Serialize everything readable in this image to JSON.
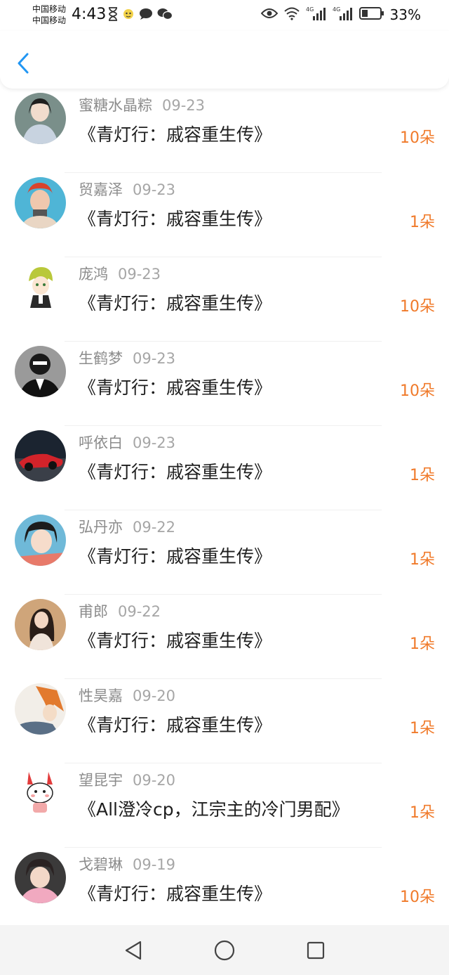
{
  "status_bar": {
    "carrier_1": "中国移动",
    "carrier_2": "中国移动",
    "time": "4:43",
    "signal_1_label": "4G",
    "signal_2_label": "4G",
    "battery": "33%",
    "battery_level": 0.33
  },
  "header": {
    "back_icon": "chevron-left-icon",
    "accent": "#2196f3"
  },
  "amount_color": "#f07a2a",
  "rows": [
    {
      "name": "蜜糖水晶粽",
      "date": "09-23",
      "book": "《青灯行：戚容重生传》",
      "amount": "10朵"
    },
    {
      "name": "贸嘉泽",
      "date": "09-23",
      "book": "《青灯行：戚容重生传》",
      "amount": "1朵"
    },
    {
      "name": "庞鸿",
      "date": "09-23",
      "book": "《青灯行：戚容重生传》",
      "amount": "10朵"
    },
    {
      "name": "生鹤梦",
      "date": "09-23",
      "book": "《青灯行：戚容重生传》",
      "amount": "10朵"
    },
    {
      "name": "呼依白",
      "date": "09-23",
      "book": "《青灯行：戚容重生传》",
      "amount": "1朵"
    },
    {
      "name": "弘丹亦",
      "date": "09-22",
      "book": "《青灯行：戚容重生传》",
      "amount": "1朵"
    },
    {
      "name": "甫郎",
      "date": "09-22",
      "book": "《青灯行：戚容重生传》",
      "amount": "1朵"
    },
    {
      "name": "性昊嘉",
      "date": "09-20",
      "book": "《青灯行：戚容重生传》",
      "amount": "1朵"
    },
    {
      "name": "望昆宇",
      "date": "09-20",
      "book": "《All澄冷cp，江宗主的冷门男配》",
      "amount": "1朵"
    },
    {
      "name": "戈碧琳",
      "date": "09-19",
      "book": "《青灯行：戚容重生传》",
      "amount": "10朵"
    }
  ],
  "nav": {
    "back": "triangle-back-icon",
    "home": "circle-home-icon",
    "recent": "square-recent-icon"
  }
}
